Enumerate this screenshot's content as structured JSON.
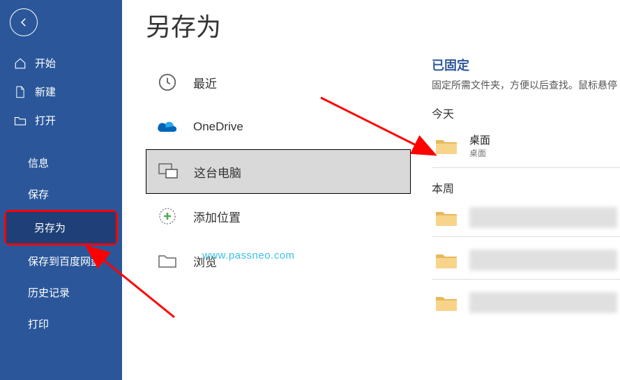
{
  "sidebar": {
    "items": [
      {
        "label": "开始"
      },
      {
        "label": "新建"
      },
      {
        "label": "打开"
      },
      {
        "label": "信息"
      },
      {
        "label": "保存"
      },
      {
        "label": "另存为"
      },
      {
        "label": "保存到百度网盘"
      },
      {
        "label": "历史记录"
      },
      {
        "label": "打印"
      }
    ]
  },
  "page": {
    "title": "另存为"
  },
  "locations": [
    {
      "label": "最近"
    },
    {
      "label": "OneDrive"
    },
    {
      "label": "这台电脑"
    },
    {
      "label": "添加位置"
    },
    {
      "label": "浏览"
    }
  ],
  "right": {
    "pinned_title": "已固定",
    "pinned_desc": "固定所需文件夹，方便以后查找。鼠标悬停",
    "today_title": "今天",
    "today_items": [
      {
        "name": "桌面",
        "path": "桌面"
      }
    ],
    "week_title": "本周"
  },
  "watermark": "www.passneo.com"
}
